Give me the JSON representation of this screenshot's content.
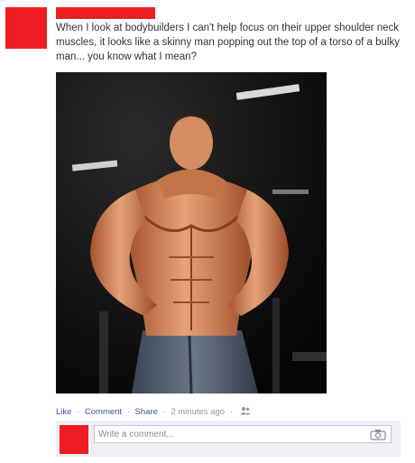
{
  "post": {
    "text": "When I look at bodybuilders I can't help focus on their upper shoulder neck muscles, it looks like a skinny man popping out the top of a torso of a bulky man... you know what I mean?"
  },
  "actions": {
    "like": "Like",
    "comment": "Comment",
    "share": "Share",
    "separator": "·",
    "timestamp": "2 minutes ago",
    "audience_icon": "people-icon"
  },
  "comment_box": {
    "placeholder": "Write a comment...",
    "attach_icon": "camera-icon"
  },
  "colors": {
    "redaction": "#ee1d22",
    "link": "#3b5998",
    "comment_bg": "#edeff4"
  }
}
